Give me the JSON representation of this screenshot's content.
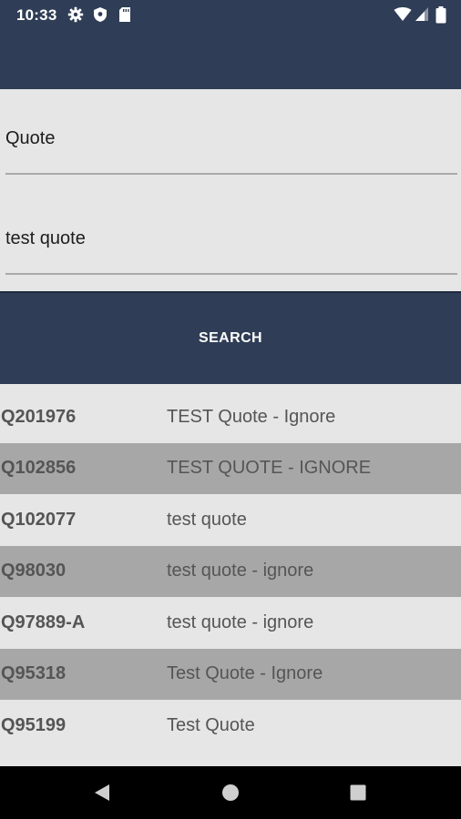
{
  "status_bar": {
    "time": "10:33",
    "icons": [
      "gear-icon",
      "shield-icon",
      "sd-card-icon",
      "wifi-icon",
      "signal-icon",
      "battery-icon"
    ]
  },
  "form": {
    "field1_value": "Quote",
    "field2_value": "test quote",
    "search_label": "SEARCH"
  },
  "results": [
    {
      "id": "Q201976",
      "desc": "TEST Quote - Ignore"
    },
    {
      "id": "Q102856",
      "desc": "TEST QUOTE - IGNORE"
    },
    {
      "id": "Q102077",
      "desc": "test quote"
    },
    {
      "id": "Q98030",
      "desc": "test quote - ignore"
    },
    {
      "id": "Q97889-A",
      "desc": "test quote - ignore"
    },
    {
      "id": "Q95318",
      "desc": "Test Quote - Ignore"
    },
    {
      "id": "Q95199",
      "desc": "Test Quote"
    }
  ],
  "nav": {
    "icons": [
      "back-icon",
      "home-icon",
      "recents-icon"
    ]
  },
  "colors": {
    "header": "#2f3d56",
    "background": "#e6e6e6",
    "row_alt": "#a7a7a7",
    "nav_bar": "#000000"
  }
}
